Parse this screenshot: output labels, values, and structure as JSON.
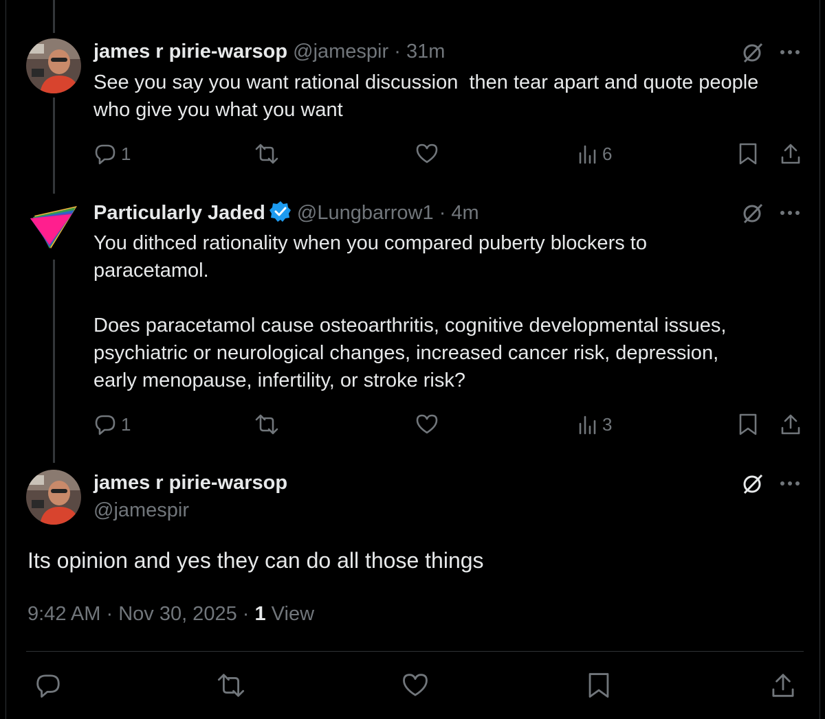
{
  "post1": {
    "name": "james r pirie-warsop",
    "handle": "@jamespir",
    "dot": " · ",
    "time": "31m",
    "text": "See you say you want rational discussion  then tear apart and quote people\nwho give you what you want",
    "replies": "1",
    "views": "6"
  },
  "post2": {
    "name": "Particularly Jaded",
    "handle": "@Lungbarrow1",
    "dot": " · ",
    "time": "4m",
    "text": "You dithced rationality when you compared puberty blockers to\nparacetamol.\n\nDoes paracetamol cause osteoarthritis, cognitive developmental issues,\npsychiatric or neurological changes, increased cancer risk, depression,\nearly menopause, infertility, or stroke risk?",
    "replies": "1",
    "views": "3"
  },
  "main": {
    "name": "james r pirie-warsop",
    "handle": "@jamespir",
    "text": "Its opinion and yes they can do all those things",
    "time": "9:42 AM",
    "dot1": " · ",
    "date": "Nov 30, 2025",
    "dot2": " · ",
    "view_count": "1",
    "view_label": " View"
  },
  "colors": {
    "background": "#000000",
    "text": "#e7e9ea",
    "muted": "#71767b",
    "verified": "#1d9bf0",
    "divider": "#2f3336"
  },
  "icons": [
    "reply-icon",
    "repost-icon",
    "like-icon",
    "views-icon",
    "bookmark-icon",
    "share-icon",
    "grok-icon",
    "more-icon",
    "verified-badge-icon"
  ]
}
